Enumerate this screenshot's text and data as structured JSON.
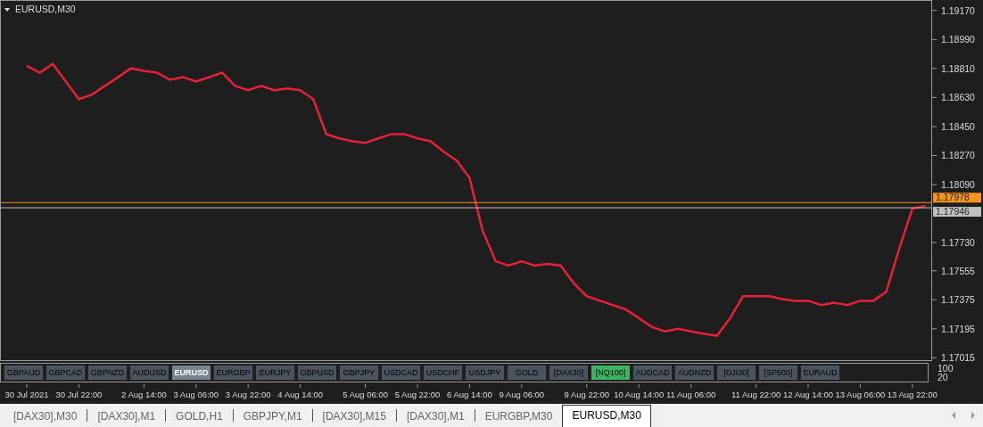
{
  "chart": {
    "title": "EURUSD,M30",
    "chart_data": {
      "type": "line",
      "categories": [
        "30 Jul 2021",
        null,
        null,
        null,
        "30 Jul 22:00",
        null,
        null,
        null,
        null,
        "2 Aug 14:00",
        null,
        null,
        null,
        "3 Aug 06:00",
        null,
        null,
        null,
        "3 Aug 22:00",
        null,
        null,
        null,
        "4 Aug 14:00",
        null,
        null,
        null,
        null,
        "5 Aug 06:00",
        null,
        null,
        null,
        "5 Aug 22:00",
        null,
        null,
        null,
        "6 Aug 14:00",
        null,
        null,
        null,
        "9 Aug 06:00",
        null,
        null,
        null,
        null,
        "9 Aug 22:00",
        null,
        null,
        null,
        "10 Aug 14:00",
        null,
        null,
        null,
        "11 Aug 06:00",
        null,
        null,
        null,
        null,
        "11 Aug 22:00",
        null,
        null,
        null,
        "12 Aug 14:00",
        null,
        null,
        null,
        "13 Aug 06:00",
        null,
        null,
        null,
        "13 Aug 22:00",
        null
      ],
      "series": [
        {
          "color": "#e8203a",
          "values": [
            1.18827,
            1.18784,
            1.18838,
            1.18729,
            1.1862,
            1.18648,
            1.18702,
            1.18756,
            1.18811,
            1.18795,
            1.18784,
            1.1874,
            1.18756,
            1.18729,
            1.18756,
            1.18784,
            1.18702,
            1.18675,
            1.18702,
            1.18675,
            1.18686,
            1.18675,
            1.1862,
            1.18403,
            1.18376,
            1.18359,
            1.18349,
            1.18376,
            1.18403,
            1.18403,
            1.18376,
            1.18359,
            1.18294,
            1.1824,
            1.18131,
            1.17804,
            1.17614,
            1.17587,
            1.17614,
            1.17587,
            1.17598,
            1.17587,
            1.17478,
            1.17397,
            1.17369,
            1.17342,
            1.17315,
            1.17261,
            1.17206,
            1.17179,
            1.17195,
            1.17179,
            1.17163,
            1.17152,
            1.17261,
            1.17397,
            1.17397,
            1.17397,
            1.1738,
            1.17369,
            1.17369,
            1.17342,
            1.17358,
            1.17342,
            1.17369,
            1.17369,
            1.17424,
            1.17696,
            1.17941,
            1.17957
          ]
        }
      ],
      "ylim": [
        1.16995,
        1.19235
      ],
      "yticks": [
        {
          "value": 1.1917,
          "label": "1.19170"
        },
        {
          "value": 1.1899,
          "label": "1.18990"
        },
        {
          "value": 1.1881,
          "label": "1.18810"
        },
        {
          "value": 1.1863,
          "label": "1.18630"
        },
        {
          "value": 1.1845,
          "label": "1.18450"
        },
        {
          "value": 1.1827,
          "label": "1.18270"
        },
        {
          "value": 1.1809,
          "label": "1.18090"
        },
        {
          "value": 1.1773,
          "label": "1.17730"
        },
        {
          "value": 1.17555,
          "label": "1.17555"
        },
        {
          "value": 1.17375,
          "label": "1.17375"
        },
        {
          "value": 1.17195,
          "label": "1.17195"
        },
        {
          "value": 1.17015,
          "label": "1.17015"
        }
      ],
      "ref_lines": [
        {
          "axis": "y",
          "value": 1.17978,
          "label": "1.17978",
          "color": "#f7931e"
        },
        {
          "axis": "y",
          "value": 1.17946,
          "label": "1.17946",
          "color": "#c0c0c0"
        }
      ]
    },
    "symbol_buttons": [
      {
        "label": "GBPAUD",
        "selected": false,
        "color": "#4b535c"
      },
      {
        "label": "GBPCAD",
        "selected": false,
        "color": "#4b535c"
      },
      {
        "label": "GBPNZD",
        "selected": false,
        "color": "#4b535c"
      },
      {
        "label": "AUDUSD",
        "selected": false,
        "color": "#4b535c"
      },
      {
        "label": "EURUSD",
        "selected": true,
        "color": "#7a848e"
      },
      {
        "label": "EURGBP",
        "selected": false,
        "color": "#4b535c"
      },
      {
        "label": "EURJPY",
        "selected": false,
        "color": "#4b535c"
      },
      {
        "label": "GBPUSD",
        "selected": false,
        "color": "#4b535c"
      },
      {
        "label": "GBPJPY",
        "selected": false,
        "color": "#4b535c"
      },
      {
        "label": "USDCAD",
        "selected": false,
        "color": "#4b535c"
      },
      {
        "label": "USDCHF",
        "selected": false,
        "color": "#4b535c"
      },
      {
        "label": "USDJPY",
        "selected": false,
        "color": "#4b535c"
      },
      {
        "label": "GOLD",
        "selected": false,
        "color": "#4b535c"
      },
      {
        "label": "[DAX30]",
        "selected": false,
        "color": "#4b535c"
      },
      {
        "label": "[NQ100]",
        "selected": false,
        "color": "#3cb563"
      },
      {
        "label": "AUDCAD",
        "selected": false,
        "color": "#4b535c"
      },
      {
        "label": "AUDNZD",
        "selected": false,
        "color": "#4b535c"
      },
      {
        "label": "[DJI30]",
        "selected": false,
        "color": "#4b535c"
      },
      {
        "label": "[SP500]",
        "selected": false,
        "color": "#4b535c"
      },
      {
        "label": "EURAUD",
        "selected": false,
        "color": "#4b535c"
      }
    ],
    "subwindow_scale": [
      "100",
      "20"
    ]
  },
  "tabs": [
    {
      "label": "[DAX30],M30",
      "selected": false
    },
    {
      "label": "[DAX30],M1",
      "selected": false
    },
    {
      "label": "GOLD,H1",
      "selected": false
    },
    {
      "label": "GBPJPY,M1",
      "selected": false
    },
    {
      "label": "[DAX30],M15",
      "selected": false
    },
    {
      "label": "[DAX30],M1",
      "selected": false
    },
    {
      "label": "EURGBP,M30",
      "selected": false
    },
    {
      "label": "EURUSD,M30",
      "selected": true
    }
  ]
}
